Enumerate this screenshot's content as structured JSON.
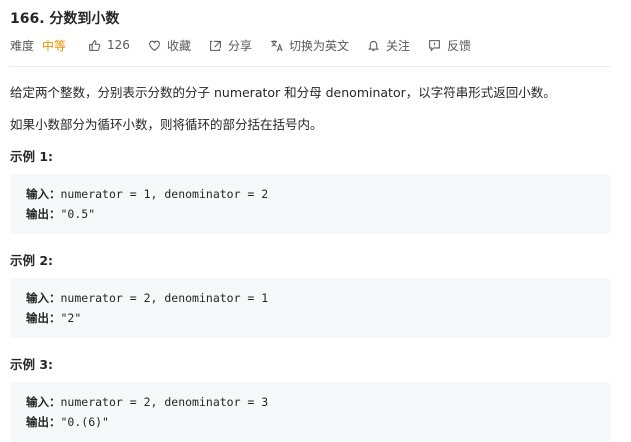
{
  "problem": {
    "title": "166. 分数到小数"
  },
  "toolbar": {
    "difficulty_label": "难度",
    "difficulty_value": "中等",
    "likes": "126",
    "favorite": "收藏",
    "share": "分享",
    "translate": "切换为英文",
    "follow": "关注",
    "feedback": "反馈"
  },
  "description": {
    "p1": "给定两个整数，分别表示分数的分子 numerator 和分母 denominator，以字符串形式返回小数。",
    "p2": "如果小数部分为循环小数，则将循环的部分括在括号内。"
  },
  "examples": [
    {
      "title": "示例 1:",
      "input_label": "输入：",
      "input": "numerator = 1, denominator = 2",
      "output_label": "输出：",
      "output": "\"0.5\""
    },
    {
      "title": "示例 2:",
      "input_label": "输入：",
      "input": "numerator = 2, denominator = 1",
      "output_label": "输出：",
      "output": "\"2\""
    },
    {
      "title": "示例 3:",
      "input_label": "输入：",
      "input": "numerator = 2, denominator = 3",
      "output_label": "输出：",
      "output": "\"0.(6)\""
    }
  ],
  "colors": {
    "difficulty_medium": "#ef8f00",
    "code_bg": "#f7f8fa",
    "text": "#262626",
    "muted": "#595959"
  }
}
